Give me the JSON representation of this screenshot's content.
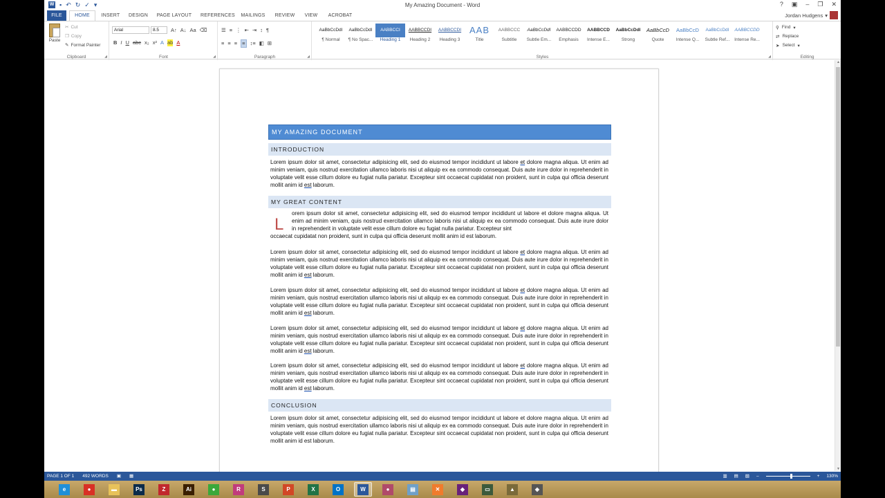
{
  "window": {
    "title": "My Amazing Document - Word"
  },
  "qat": {
    "undo": "↶",
    "redo": "↻",
    "save": "💾"
  },
  "tabs": {
    "file": "FILE",
    "home": "HOME",
    "insert": "INSERT",
    "design": "DESIGN",
    "page_layout": "PAGE LAYOUT",
    "references": "REFERENCES",
    "mailings": "MAILINGS",
    "review": "REVIEW",
    "view": "VIEW",
    "acrobat": "ACROBAT"
  },
  "user": {
    "name": "Jordan Hudgens"
  },
  "ribbon": {
    "clipboard": {
      "label": "Clipboard",
      "paste": "Paste",
      "cut": "Cut",
      "copy": "Copy",
      "format_painter": "Format Painter"
    },
    "font": {
      "label": "Font",
      "family": "Arial",
      "size": "8.5"
    },
    "paragraph": {
      "label": "Paragraph"
    },
    "styles": {
      "label": "Styles",
      "items": [
        {
          "preview": "AaBbCcDdI",
          "name": "¶ Normal"
        },
        {
          "preview": "AaBbCcDdI",
          "name": "¶ No Spac..."
        },
        {
          "preview": "AABBCCI",
          "name": "Heading 1"
        },
        {
          "preview": "AABBCCDI",
          "name": "Heading 2"
        },
        {
          "preview": "AABBCCDI",
          "name": "Heading 3"
        },
        {
          "preview": "AAB",
          "name": "Title"
        },
        {
          "preview": "AABBCCC",
          "name": "Subtitle"
        },
        {
          "preview": "AaBbCcDdI",
          "name": "Subtle Em..."
        },
        {
          "preview": "AABBCCDD",
          "name": "Emphasis"
        },
        {
          "preview": "AABBCCD",
          "name": "Intense E..."
        },
        {
          "preview": "AaBbCcDdI",
          "name": "Strong"
        },
        {
          "preview": "AaBbCcD",
          "name": "Quote"
        },
        {
          "preview": "AaBbCcD",
          "name": "Intense Q..."
        },
        {
          "preview": "AaBbCcDdI",
          "name": "Subtle Ref..."
        },
        {
          "preview": "AABBCCDD",
          "name": "Intense Re..."
        }
      ]
    },
    "editing": {
      "label": "Editing",
      "find": "Find",
      "replace": "Replace",
      "select": "Select"
    }
  },
  "document": {
    "title": "MY AMAZING DOCUMENT",
    "sections": {
      "intro_heading": "INTRODUCTION",
      "content_heading": "MY GREAT CONTENT",
      "conclusion_heading": "CONCLUSION"
    },
    "dropcap_letter": "L",
    "dropcap_rest_first_word": "orem",
    "lorem_a": "Lorem ipsum dolor sit amet, consectetur adipisicing elit, sed do eiusmod tempor incididunt ut labore ",
    "lorem_et": "et",
    "lorem_b": " dolore magna aliqua. Ut enim ad minim veniam, quis nostrud exercitation ullamco laboris nisi ut aliquip ex ea commodo consequat. Duis aute irure dolor in reprehenderit in voluptate velit esse cillum dolore eu fugiat nulla pariatur. Excepteur sint occaecat cupidatat non proident, sunt in culpa qui officia deserunt mollit anim id ",
    "lorem_est": "est",
    "lorem_c": " laborum.",
    "dropcap_para": " ipsum dolor sit amet, consectetur adipisicing elit, sed do eiusmod tempor incididunt ut labore et dolore magna aliqua. Ut enim ad minim veniam, quis nostrud exercitation ullamco laboris nisi ut aliquip ex ea commodo consequat. Duis aute irure dolor in reprehenderit in voluptate velit esse cillum dolore eu fugiat nulla pariatur. Excepteur sint",
    "dropcap_tail": "occaecat cupidatat non proident, sunt in culpa qui officia deserunt mollit anim id est laborum.",
    "conclusion_para": "Lorem ipsum dolor sit amet, consectetur adipisicing elit, sed do eiusmod tempor incididunt ut labore et dolore magna aliqua. Ut enim ad minim veniam, quis nostrud exercitation ullamco laboris nisi ut aliquip ex ea commodo consequat. Duis aute irure dolor in reprehenderit in voluptate velit esse cillum dolore eu fugiat nulla pariatur. Excepteur sint occaecat cupidatat non proident, sunt in culpa qui officia deserunt mollit anim id est laborum."
  },
  "status": {
    "page": "PAGE 1 OF 1",
    "words": "492 WORDS",
    "zoom": "130%"
  },
  "taskbar": {
    "items": [
      {
        "icon": "ie-icon",
        "glyph": "e",
        "color": "#1f8fd8"
      },
      {
        "icon": "chrome-icon",
        "glyph": "●",
        "color": "#d93025"
      },
      {
        "icon": "explorer-icon",
        "glyph": "▬",
        "color": "#e8c25a"
      },
      {
        "icon": "photoshop-icon",
        "glyph": "Ps",
        "color": "#0b2b4a"
      },
      {
        "icon": "filezilla-icon",
        "glyph": "Z",
        "color": "#c1272d"
      },
      {
        "icon": "illustrator-icon",
        "glyph": "Ai",
        "color": "#3a1f00"
      },
      {
        "icon": "app-green-icon",
        "glyph": "●",
        "color": "#3aa83a"
      },
      {
        "icon": "rubymine-icon",
        "glyph": "R",
        "color": "#c13b7c"
      },
      {
        "icon": "sublime-icon",
        "glyph": "S",
        "color": "#4a4a4a"
      },
      {
        "icon": "powerpoint-icon",
        "glyph": "P",
        "color": "#d24726"
      },
      {
        "icon": "excel-icon",
        "glyph": "X",
        "color": "#217346"
      },
      {
        "icon": "outlook-icon",
        "glyph": "O",
        "color": "#0072c6"
      },
      {
        "icon": "word-icon",
        "glyph": "W",
        "color": "#2b579a"
      },
      {
        "icon": "snagit-icon",
        "glyph": "●",
        "color": "#b04a6a"
      },
      {
        "icon": "notepad-icon",
        "glyph": "▤",
        "color": "#6fa0c8"
      },
      {
        "icon": "xampp-icon",
        "glyph": "✕",
        "color": "#f07b2c"
      },
      {
        "icon": "visual-studio-icon",
        "glyph": "◆",
        "color": "#68217a"
      },
      {
        "icon": "terminal-icon",
        "glyph": "▭",
        "color": "#3c5a3c"
      },
      {
        "icon": "bottle-icon",
        "glyph": "▲",
        "color": "#7a6a3a"
      },
      {
        "icon": "tool-icon",
        "glyph": "◈",
        "color": "#555555"
      }
    ]
  }
}
